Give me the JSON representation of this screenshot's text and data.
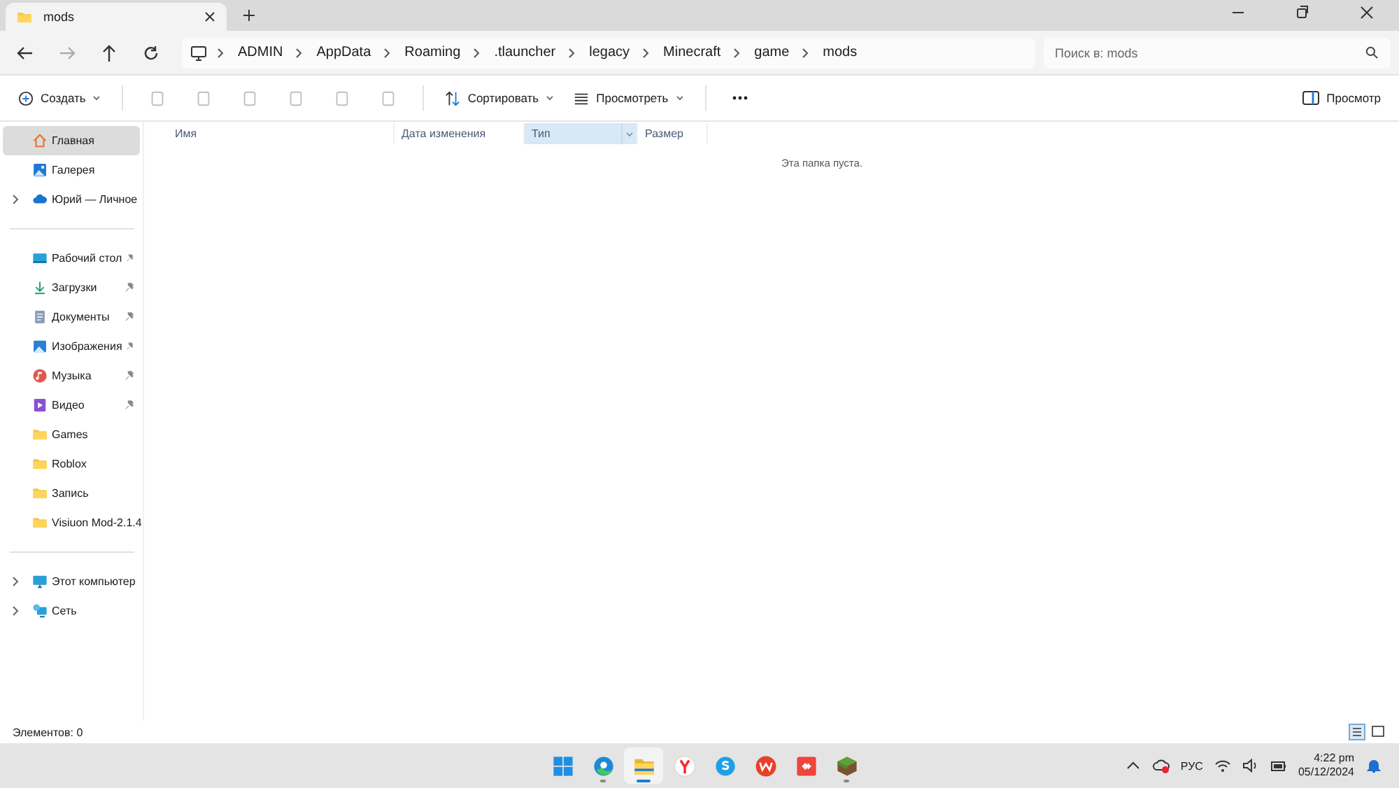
{
  "tab": {
    "title": "mods"
  },
  "breadcrumb": [
    "ADMIN",
    "AppData",
    "Roaming",
    ".tlauncher",
    "legacy",
    "Minecraft",
    "game",
    "mods"
  ],
  "search": {
    "placeholder": "Поиск в: mods"
  },
  "toolbar": {
    "create": "Создать",
    "sort": "Сортировать",
    "view": "Просмотреть",
    "preview": "Просмотр"
  },
  "sidebar": {
    "sections": [
      [
        {
          "label": "Главная",
          "kind": "home",
          "selected": true,
          "expandable": false,
          "pinned": false
        },
        {
          "label": "Галерея",
          "kind": "gallery",
          "selected": false,
          "expandable": false,
          "pinned": false
        },
        {
          "label": "Юрий — Личное",
          "kind": "cloud",
          "selected": false,
          "expandable": true,
          "pinned": false
        }
      ],
      [
        {
          "label": "Рабочий стол",
          "kind": "desktop",
          "selected": false,
          "expandable": false,
          "pinned": true
        },
        {
          "label": "Загрузки",
          "kind": "downloads",
          "selected": false,
          "expandable": false,
          "pinned": true
        },
        {
          "label": "Документы",
          "kind": "documents",
          "selected": false,
          "expandable": false,
          "pinned": true
        },
        {
          "label": "Изображения",
          "kind": "pictures",
          "selected": false,
          "expandable": false,
          "pinned": true
        },
        {
          "label": "Музыка",
          "kind": "music",
          "selected": false,
          "expandable": false,
          "pinned": true
        },
        {
          "label": "Видео",
          "kind": "video",
          "selected": false,
          "expandable": false,
          "pinned": true
        },
        {
          "label": "Games",
          "kind": "folder",
          "selected": false,
          "expandable": false,
          "pinned": false
        },
        {
          "label": "Roblox",
          "kind": "folder",
          "selected": false,
          "expandable": false,
          "pinned": false
        },
        {
          "label": "Запись",
          "kind": "folder",
          "selected": false,
          "expandable": false,
          "pinned": false
        },
        {
          "label": "Visiuon Mod-2.1.4",
          "kind": "folder",
          "selected": false,
          "expandable": false,
          "pinned": false
        }
      ],
      [
        {
          "label": "Этот компьютер",
          "kind": "pc",
          "selected": false,
          "expandable": true,
          "pinned": false
        },
        {
          "label": "Сеть",
          "kind": "network",
          "selected": false,
          "expandable": true,
          "pinned": false
        }
      ]
    ]
  },
  "columns": [
    {
      "label": "Имя",
      "selected": false
    },
    {
      "label": "Дата изменения",
      "selected": false
    },
    {
      "label": "Тип",
      "selected": true
    },
    {
      "label": "Размер",
      "selected": false
    }
  ],
  "empty_message": "Эта папка пуста.",
  "status_bar": {
    "items": "Элементов: 0"
  },
  "taskbar": {
    "apps": [
      {
        "kind": "windows",
        "selected": false,
        "running": false
      },
      {
        "kind": "edge",
        "selected": false,
        "running": true
      },
      {
        "kind": "explorer",
        "selected": true,
        "running": true
      },
      {
        "kind": "yandex",
        "selected": false,
        "running": false
      },
      {
        "kind": "skype",
        "selected": false,
        "running": false
      },
      {
        "kind": "wps",
        "selected": false,
        "running": false
      },
      {
        "kind": "anydesk",
        "selected": false,
        "running": false
      },
      {
        "kind": "minecraft",
        "selected": false,
        "running": true
      }
    ],
    "language": "РУС",
    "time": "4:22 pm",
    "date": "05/12/2024"
  }
}
